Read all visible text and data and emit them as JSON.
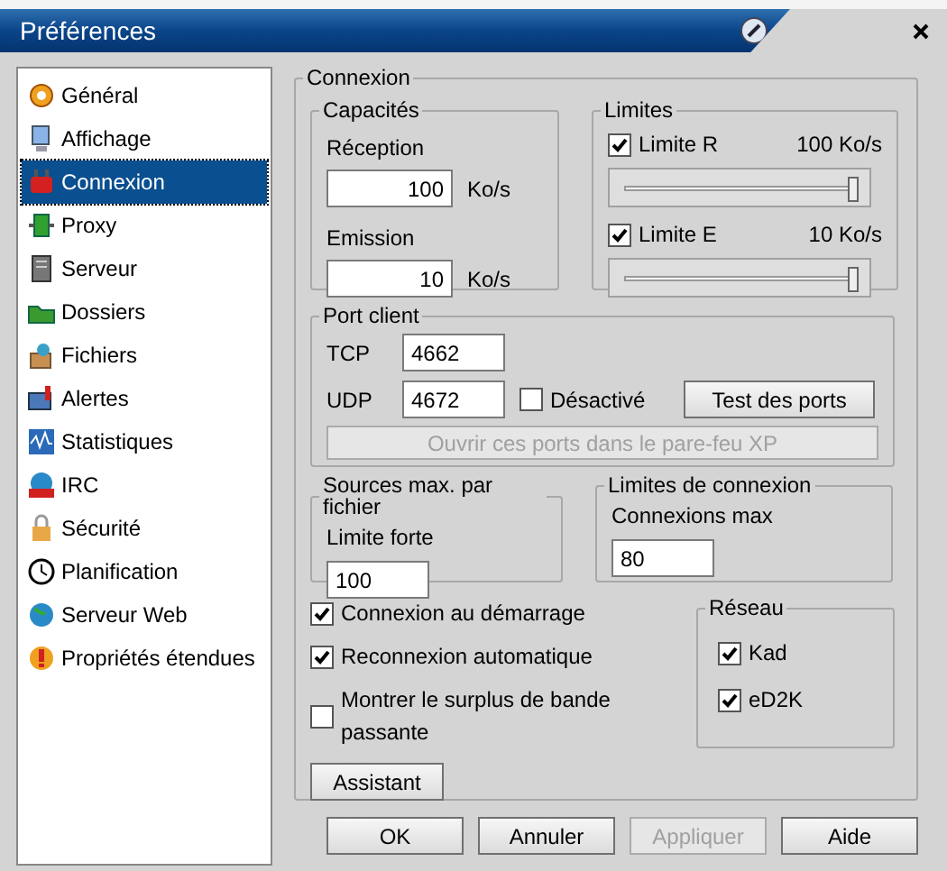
{
  "window": {
    "title": "Préférences"
  },
  "sidebar": {
    "items": [
      {
        "label": "Général",
        "selected": false
      },
      {
        "label": "Affichage",
        "selected": false
      },
      {
        "label": "Connexion",
        "selected": true
      },
      {
        "label": "Proxy",
        "selected": false
      },
      {
        "label": "Serveur",
        "selected": false
      },
      {
        "label": "Dossiers",
        "selected": false
      },
      {
        "label": "Fichiers",
        "selected": false
      },
      {
        "label": "Alertes",
        "selected": false
      },
      {
        "label": "Statistiques",
        "selected": false
      },
      {
        "label": "IRC",
        "selected": false
      },
      {
        "label": "Sécurité",
        "selected": false
      },
      {
        "label": "Planification",
        "selected": false
      },
      {
        "label": "Serveur Web",
        "selected": false
      },
      {
        "label": "Propriétés étendues",
        "selected": false
      }
    ]
  },
  "panel": {
    "title": "Connexion",
    "capacities": {
      "title": "Capacités",
      "fields": [
        {
          "label": "Réception",
          "value": "100",
          "unit": "Ko/s"
        },
        {
          "label": "Emission",
          "value": "10",
          "unit": "Ko/s"
        }
      ]
    },
    "limits": {
      "title": "Limites",
      "items": [
        {
          "label": "Limite R",
          "checked": true,
          "reading": "100 Ko/s",
          "level": 1
        },
        {
          "label": "Limite E",
          "checked": true,
          "reading": "10 Ko/s",
          "level": 1
        }
      ]
    },
    "client_port": {
      "title": "Port client",
      "fields": [
        {
          "label": "TCP",
          "value": "4662"
        },
        {
          "label": "UDP",
          "value": "4672"
        }
      ],
      "disable": {
        "label": "Désactivé",
        "checked": false
      },
      "test_button": "Test des ports",
      "firewall_button": {
        "label": "Ouvrir ces ports dans le pare-feu XP",
        "disabled": true
      }
    },
    "sources": {
      "title": "Sources max. par fichier",
      "label": "Limite forte",
      "value": "100"
    },
    "connection_limits": {
      "title": "Limites de connexion",
      "label": "Connexions max",
      "value": "80"
    },
    "options": [
      {
        "label": "Connexion au démarrage",
        "checked": true
      },
      {
        "label": "Reconnexion automatique",
        "checked": true
      },
      {
        "label": "Montrer le surplus de bande passante",
        "checked": false
      }
    ],
    "assistant_button": "Assistant",
    "network": {
      "title": "Réseau",
      "items": [
        {
          "label": "Kad",
          "checked": true
        },
        {
          "label": "eD2K",
          "checked": true
        }
      ]
    }
  },
  "buttons": [
    {
      "label": "OK",
      "disabled": false
    },
    {
      "label": "Annuler",
      "disabled": false
    },
    {
      "label": "Appliquer",
      "disabled": true
    },
    {
      "label": "Aide",
      "disabled": false
    }
  ]
}
